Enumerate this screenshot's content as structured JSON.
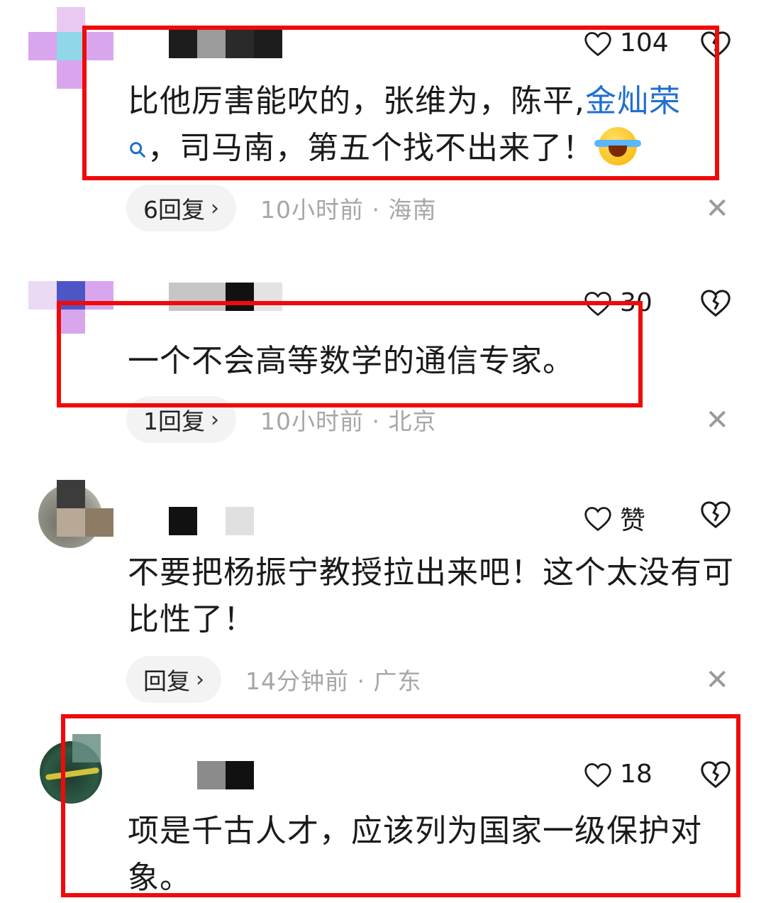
{
  "comments": [
    {
      "likes": "104",
      "text_a": "比他厉害能吹的，张维为，陈平,",
      "link": "金灿荣",
      "text_b": "，司马南，第五个找不出来了！",
      "reply": "6回复",
      "meta": "10小时前 · 海南"
    },
    {
      "likes": "30",
      "text": "一个不会高等数学的通信专家。",
      "reply": "1回复",
      "meta": "10小时前 · 北京"
    },
    {
      "likes": "赞",
      "text": "不要把杨振宁教授拉出来吧！这个太没有可比性了！",
      "reply": "回复",
      "meta": "14分钟前 · 广东"
    },
    {
      "likes": "18",
      "text": "项是千古人才，应该列为国家一级保护对象。"
    }
  ],
  "icons": {
    "like": "heart-outline-icon",
    "dislike": "broken-heart-icon",
    "close": "close-icon",
    "search": "search-icon",
    "emoji": "laughing-tears-emoji"
  },
  "colors": {
    "link": "#1f6fd1",
    "highlight_box": "#f00a0a",
    "meta_text": "#a6a6a6",
    "pill_bg": "#f3f3f3"
  }
}
